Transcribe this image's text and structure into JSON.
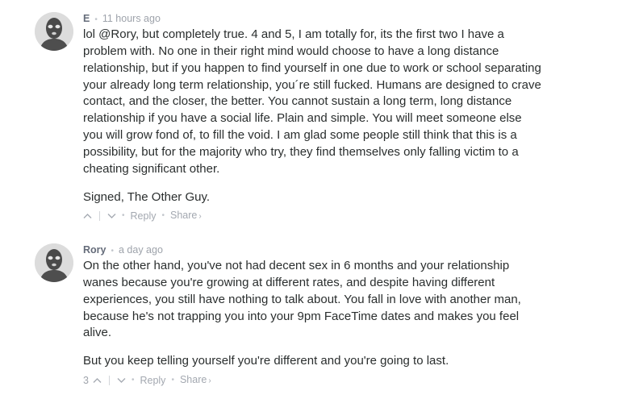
{
  "comments": [
    {
      "author": "E",
      "time": "11 hours ago",
      "paragraphs": [
        "lol @Rory, but completely true. 4 and 5, I am totally for, its the first two I have a problem with. No one in their right mind would choose to have a long distance relationship, but if you happen to find yourself in one due to work or school separating your already long term relationship, you´re still fucked. Humans are designed to crave contact, and the closer, the better. You cannot sustain a long term, long distance relationship if you have a social life. Plain and simple. You will meet someone else you will grow fond of, to fill the void. I am glad some people still think that this is a possibility, but for the majority who try, they find themselves only falling victim to a cheating significant other.",
        "Signed, The Other Guy."
      ],
      "upvotes": "",
      "reply_label": "Reply",
      "share_label": "Share",
      "share_chevron": "›",
      "avatar_icon": "balaclava-avatar-icon"
    },
    {
      "author": "Rory",
      "time": "a day ago",
      "paragraphs": [
        "On the other hand, you've not had decent sex in 6 months and your relationship wanes because you're growing at different rates, and despite having different experiences, you still have nothing to talk about. You fall in love with another man, because he's not trapping you into your 9pm FaceTime dates and makes you feel alive.",
        "But you keep telling yourself you're different and you're going to last."
      ],
      "upvotes": "3",
      "reply_label": "Reply",
      "share_label": "Share",
      "share_chevron": "›",
      "avatar_icon": "balaclava-avatar-icon"
    }
  ],
  "separator": "•",
  "colors": {
    "text": "#2a2e2e",
    "meta": "#9ea3ab",
    "author": "#656c7a",
    "avatar_bg": "#dcdcdc",
    "avatar_figure": "#4a4a4a"
  }
}
